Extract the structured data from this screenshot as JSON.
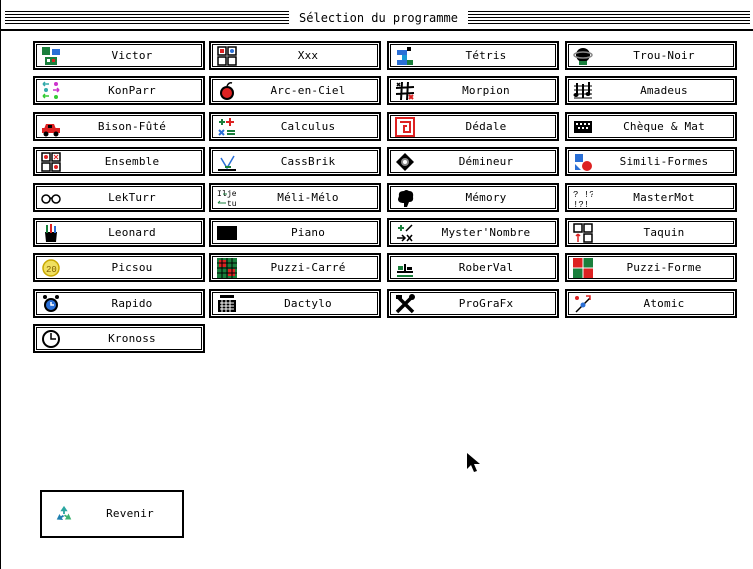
{
  "window": {
    "title": "Sélection du programme"
  },
  "programs": [
    {
      "label": "Victor",
      "icon": "robot-icon"
    },
    {
      "label": "Xxx",
      "icon": "puzzle-grid-icon"
    },
    {
      "label": "Tétris",
      "icon": "tetris-blocks-icon"
    },
    {
      "label": "Trou-Noir",
      "icon": "black-hole-icon"
    },
    {
      "label": "KonParr",
      "icon": "matching-arrows-icon"
    },
    {
      "label": "Arc-en-Ciel",
      "icon": "apple-icon"
    },
    {
      "label": "Morpion",
      "icon": "tic-tac-toe-icon"
    },
    {
      "label": "Amadeus",
      "icon": "music-notes-icon"
    },
    {
      "label": "Bison-Fûté",
      "icon": "car-icon"
    },
    {
      "label": "Calculus",
      "icon": "math-operators-icon"
    },
    {
      "label": "Dédale",
      "icon": "maze-icon"
    },
    {
      "label": "Chèque & Mat",
      "icon": "keyboard-icon"
    },
    {
      "label": "Ensemble",
      "icon": "sets-grid-icon"
    },
    {
      "label": "CassBrik",
      "icon": "brick-breaker-icon"
    },
    {
      "label": "Démineur",
      "icon": "mine-icon"
    },
    {
      "label": "Simili-Formes",
      "icon": "shapes-icon"
    },
    {
      "label": "LekTurr",
      "icon": "glasses-icon"
    },
    {
      "label": "Méli-Mélo",
      "icon": "word-scramble-icon"
    },
    {
      "label": "Mémory",
      "icon": "brain-icon"
    },
    {
      "label": "MasterMot",
      "icon": "question-marks-icon"
    },
    {
      "label": "Leonard",
      "icon": "paint-pot-icon"
    },
    {
      "label": "Piano",
      "icon": "black-rectangle-icon"
    },
    {
      "label": "Myster'Nombre",
      "icon": "mystery-number-icon"
    },
    {
      "label": "Taquin",
      "icon": "sliding-tiles-icon"
    },
    {
      "label": "Picsou",
      "icon": "coin-icon"
    },
    {
      "label": "Puzzi-Carré",
      "icon": "puzzle-square-icon"
    },
    {
      "label": "RoberVal",
      "icon": "balance-scale-icon"
    },
    {
      "label": "Puzzi-Forme",
      "icon": "puzzle-shape-icon"
    },
    {
      "label": "Rapido",
      "icon": "alarm-clock-icon"
    },
    {
      "label": "Dactylo",
      "icon": "typewriter-icon"
    },
    {
      "label": "ProGraFx",
      "icon": "tools-icon"
    },
    {
      "label": "Atomic",
      "icon": "atom-icon"
    },
    {
      "label": "Kronoss",
      "icon": "clock-icon"
    }
  ],
  "footer": {
    "revenir_label": "Revenir",
    "revenir_icon": "recycle-icon"
  }
}
